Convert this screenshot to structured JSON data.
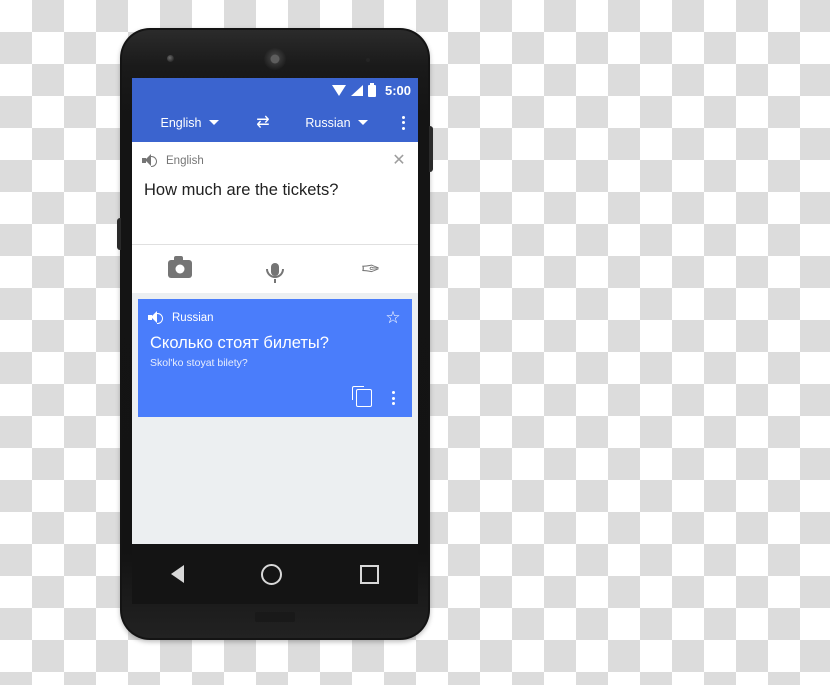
{
  "device": {
    "name": "android-phone-mockup",
    "hardware": {
      "earpiece": "earpiece-speaker",
      "front_camera": "front-camera",
      "proximity_sensor": "proximity-sensor"
    }
  },
  "status_bar": {
    "time": "5:00",
    "icons": [
      "wifi-icon",
      "signal-icon",
      "battery-icon"
    ]
  },
  "toolbar": {
    "source_language": "English",
    "target_language": "Russian",
    "swap_label": "⇄",
    "overflow_label": "more-options"
  },
  "source_card": {
    "language_label": "English",
    "speaker_icon": "speaker-icon",
    "close_label": "✕",
    "text": "How much are the tickets?",
    "input_methods": [
      {
        "name": "camera-input",
        "icon": "camera-icon"
      },
      {
        "name": "voice-input",
        "icon": "microphone-icon"
      },
      {
        "name": "handwriting-input",
        "icon": "handwriting-icon",
        "glyph": "✑"
      }
    ]
  },
  "translation_card": {
    "language_label": "Russian",
    "speaker_icon": "speaker-icon",
    "star_label": "☆",
    "text": "Сколько стоят билеты?",
    "transliteration": "Skol'ko stoyat bilety?",
    "copy_label": "copy-icon",
    "overflow_label": "more-options",
    "background_color": "#4a7dfb"
  },
  "navigation_bar": {
    "back": "back-triangle",
    "home": "home-circle",
    "recents": "recents-square"
  },
  "colors": {
    "toolbar_blue": "#3b64cf",
    "card_blue": "#4a7dfb",
    "screen_background": "#eceff1"
  }
}
